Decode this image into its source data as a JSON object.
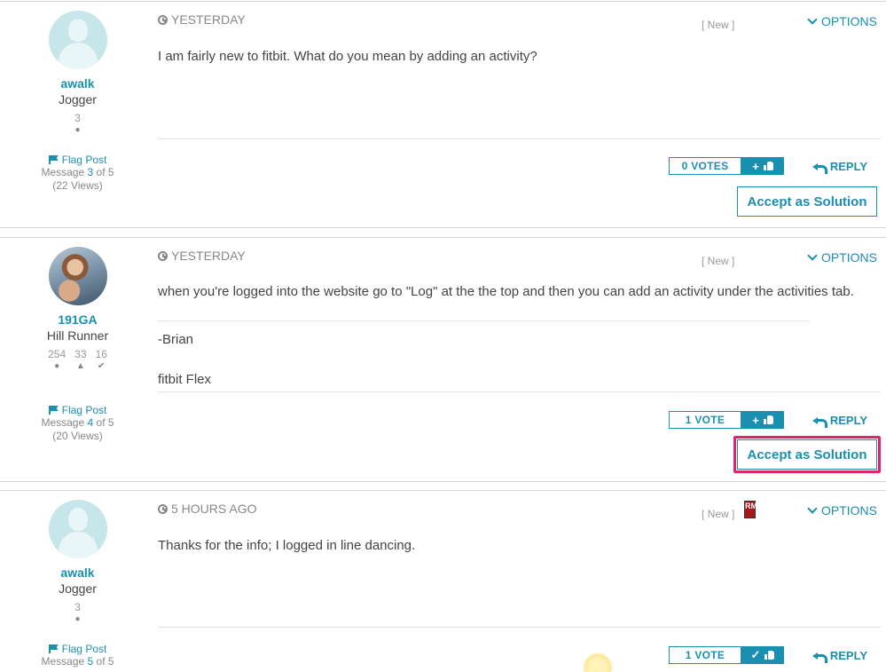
{
  "posts": [
    {
      "author": {
        "name": "awalk",
        "rank": "Jogger",
        "stats": [
          {
            "value": "3",
            "icon": "comment-icon"
          }
        ]
      },
      "timestamp": "YESTERDAY",
      "new_label": "[ New ]",
      "options_label": "OPTIONS",
      "body": [
        "I am fairly new to fitbit. What do you mean by adding an activity?"
      ],
      "flag_label": "Flag Post",
      "message_prefix": "Message",
      "message_number": "3",
      "message_suffix": "of 5",
      "views": "(22 Views)",
      "votes_label": "0 VOTES",
      "vote_button": "+",
      "reply_label": "REPLY",
      "accept_label": "Accept as Solution"
    },
    {
      "author": {
        "name": "191GA",
        "rank": "Hill Runner",
        "stats": [
          {
            "value": "254",
            "icon": "comment-icon"
          },
          {
            "value": "33",
            "icon": "thumbs-up-icon"
          },
          {
            "value": "16",
            "icon": "check-icon"
          }
        ]
      },
      "timestamp": "YESTERDAY",
      "new_label": "[ New ]",
      "options_label": "OPTIONS",
      "body": [
        "when you're logged into the website go to \"Log\" at the the top and then you can add an activity under the activities tab."
      ],
      "signature": [
        "-Brian",
        "fitbit Flex"
      ],
      "flag_label": "Flag Post",
      "message_prefix": "Message",
      "message_number": "4",
      "message_suffix": "of 5",
      "views": "(20 Views)",
      "votes_label": "1 VOTE",
      "vote_button": "+",
      "reply_label": "REPLY",
      "accept_label": "Accept as Solution",
      "highlight_color": "#e0236b"
    },
    {
      "author": {
        "name": "awalk",
        "rank": "Jogger",
        "stats": [
          {
            "value": "3",
            "icon": "comment-icon"
          }
        ]
      },
      "timestamp": "5 HOURS AGO",
      "new_label": "[ New ]",
      "badge": "RM",
      "options_label": "OPTIONS",
      "body": [
        "Thanks for the info; I logged in line dancing."
      ],
      "flag_label": "Flag Post",
      "message_prefix": "Message",
      "message_number": "5",
      "message_suffix": "of 5",
      "votes_label": "1 VOTE",
      "vote_button": "✓",
      "reply_label": "REPLY"
    }
  ],
  "colors": {
    "accent": "#1b8fb0",
    "highlight": "#e0236b",
    "text": "#444444",
    "muted": "#888888"
  }
}
